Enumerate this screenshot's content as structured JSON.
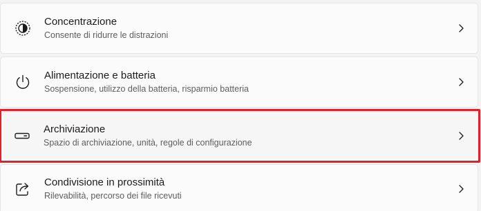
{
  "settings_items": [
    {
      "title": "Concentrazione",
      "subtitle": "Consente di ridurre le distrazioni",
      "icon": "focus-icon"
    },
    {
      "title": "Alimentazione e batteria",
      "subtitle": "Sospensione, utilizzo della batteria, risparmio batteria",
      "icon": "power-icon"
    },
    {
      "title": "Archiviazione",
      "subtitle": "Spazio di archiviazione, unità, regole di configurazione",
      "icon": "storage-icon"
    },
    {
      "title": "Condivisione in prossimità",
      "subtitle": "Rilevabilità, percorso dei file ricevuti",
      "icon": "share-icon"
    }
  ],
  "colors": {
    "highlight_border": "#e2202c",
    "card_background": "#fbfbfb",
    "page_background": "#f3f3f3"
  }
}
